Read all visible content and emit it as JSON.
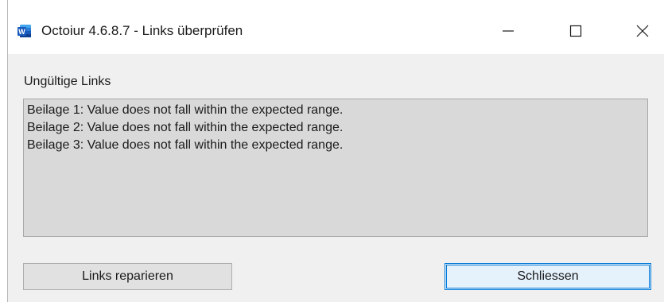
{
  "window": {
    "title": "Octoiur 4.6.8.7 - Links überprüfen",
    "app_icon_letter": "W",
    "accent_color": "#185abd"
  },
  "controls": {
    "minimize": "minimize-icon",
    "maximize": "maximize-icon",
    "close": "close-icon"
  },
  "content": {
    "group_label": "Ungültige Links",
    "invalid_links": [
      "Beilage 1: Value does not fall within the expected range.",
      "Beilage 2: Value does not fall within the expected range.",
      "Beilage 3: Value does not fall within the expected range."
    ]
  },
  "buttons": {
    "repair_label": "Links reparieren",
    "close_label": "Schliessen"
  }
}
